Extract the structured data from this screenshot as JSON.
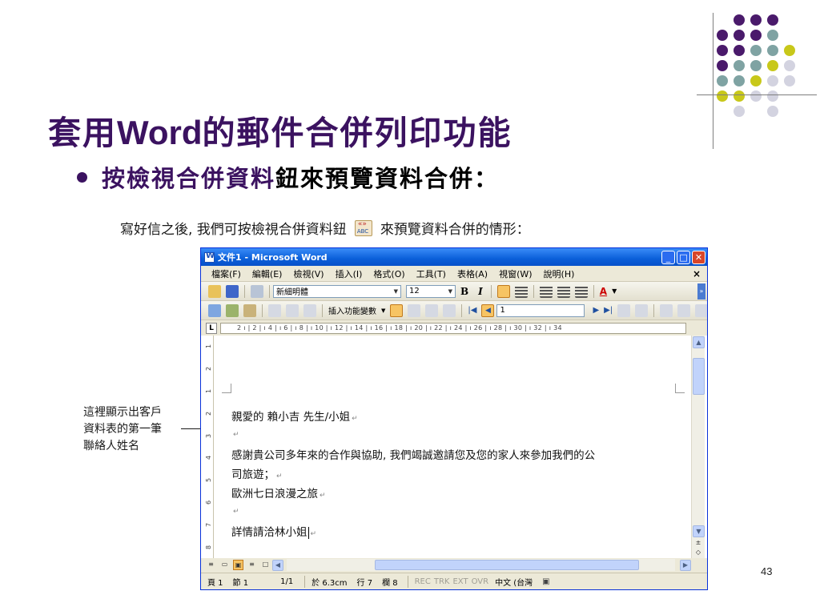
{
  "slide": {
    "title_zh_1": "套用",
    "title_latin": "Word",
    "title_zh_2": "的郵件合併列印功能",
    "bullet_part1": "按檢視合併資料",
    "bullet_part2": "鈕來預覽資料合併：",
    "intro_part1": "寫好信之後, 我們可按檢視合併資料鈕",
    "intro_part2": "來預覽資料合併的情形：",
    "callout": [
      "這裡顯示出客戶",
      "資料表的第一筆",
      "聯絡人姓名"
    ],
    "page_number": "43",
    "colors": {
      "title": "#3b1260",
      "dot_purple": "#4a1a6b",
      "dot_teal": "#7fa3a3",
      "dot_yellow": "#c8c81a",
      "dot_lavender": "#d3d3e0"
    }
  },
  "window": {
    "title": "文件1 - Microsoft Word",
    "controls": {
      "minimize": "_",
      "maximize": "□",
      "close": "✕"
    },
    "menu": [
      "檔案(F)",
      "編輯(E)",
      "檢視(V)",
      "插入(I)",
      "格式(O)",
      "工具(T)",
      "表格(A)",
      "視窗(W)",
      "說明(H)"
    ],
    "menu_close": "×",
    "toolbar": {
      "font_name": "新細明體",
      "font_size": "12",
      "bold": "B",
      "italic": "I",
      "font_color_letter": "A",
      "insert_field_label": "插入功能變數",
      "record_number": "1"
    },
    "ruler_text": "2 ı | 2 | ı 4 | ı 6 | ı 8 | ı 10 | ı 12 | ı 14 | ı 16 | ı 18 | ı 20 | ı 22 | ı 24 | ı 26 | ı 28 | ı 30 | ı 32 | ı 34",
    "vruler_marks": [
      "1",
      "2",
      "1",
      "2",
      "3",
      "4",
      "5",
      "6",
      "7",
      "8"
    ],
    "document": {
      "line1": "親愛的 賴小吉 先生/小姐",
      "line2": "",
      "line3": "感謝貴公司多年來的合作與協助, 我們竭誠邀請您及您的家人來參加我們的公",
      "line4": "司旅遊；",
      "line5": "歐洲七日浪漫之旅",
      "line6": "",
      "line7": "詳情請洽林小姐"
    },
    "paragraph_mark": "↵",
    "statusbar": {
      "page": "頁 1",
      "section": "節 1",
      "page_count": "1/1",
      "position": "於 6.3cm",
      "line": "行 7",
      "column": "欄 8",
      "rec": "REC",
      "trk": "TRK",
      "ext": "EXT",
      "ovr": "OVR",
      "language": "中文 (台灣"
    }
  }
}
